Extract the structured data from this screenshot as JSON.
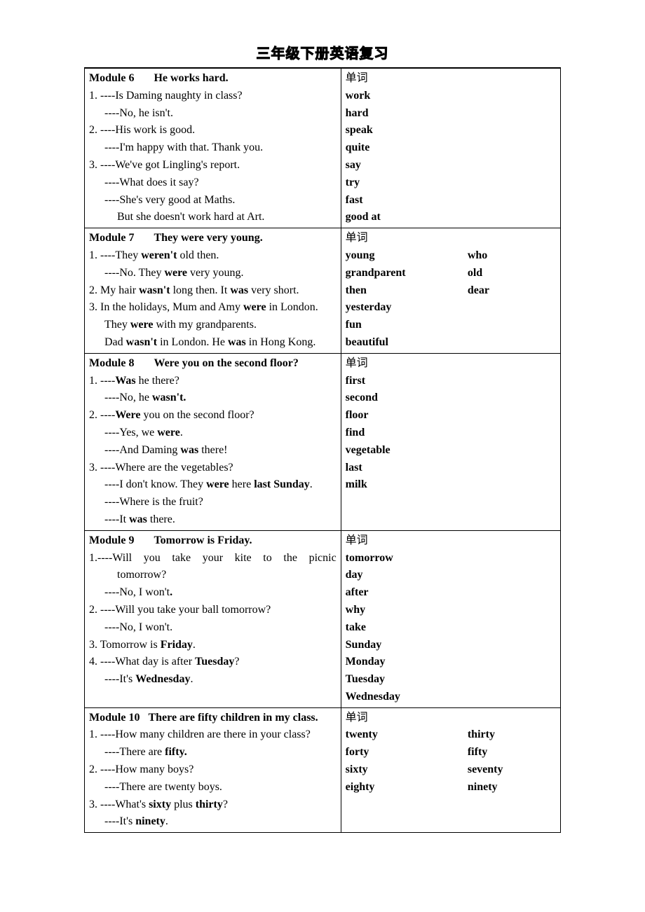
{
  "title": "三年级下册英语复习",
  "vocab_header": "单词",
  "mod6": {
    "header_a": "Module 6",
    "header_b": "He works hard.",
    "l1": "1. ----Is Daming naughty in class?",
    "l1a": "----No, he isn't.",
    "l2": "2. ----His work is good.",
    "l2a": "----I'm happy with that. Thank you.",
    "l3": "3. ----We've got Lingling's report.",
    "l3a": "----What does it say?",
    "l3b": "----She's very good at Maths.",
    "l3c": "But she doesn't work hard at Art.",
    "v": [
      "work",
      "hard",
      "speak",
      "quite",
      "say",
      "try",
      "fast",
      "good at"
    ]
  },
  "mod7": {
    "header_a": "Module 7",
    "header_b": "They were very young.",
    "l1a": "1. ----They ",
    "l1b": "weren't",
    "l1c": " old then.",
    "l1d": "----No. They ",
    "l1e": "were",
    "l1f": " very young.",
    "l2a": "2. My hair ",
    "l2b": "wasn't",
    "l2c": " long then. It ",
    "l2d": "was",
    "l2e": " very short.",
    "l3a": "3. In the holidays, Mum and Amy ",
    "l3b": "were",
    "l3c": " in London.",
    "l3d": "They ",
    "l3e": "were",
    "l3f": " with my grandparents.",
    "l3g": "Dad ",
    "l3h": "wasn't",
    "l3i": " in London. He ",
    "l3j": "was",
    "l3k": " in Hong Kong.",
    "v": [
      [
        "young",
        "who"
      ],
      [
        "grandparent",
        "old"
      ],
      [
        "then",
        "dear"
      ],
      [
        "yesterday",
        ""
      ],
      [
        "fun",
        ""
      ],
      [
        "beautiful",
        ""
      ]
    ]
  },
  "mod8": {
    "header_a": "Module 8",
    "header_b": "Were you on the second floor?",
    "l1a": "1. ----",
    "l1b": "Was",
    "l1c": " he there?",
    "l1d": "----No, he ",
    "l1e": "wasn't.",
    "l2a": "2. ----",
    "l2b": "Were",
    "l2c": " you on the second floor?",
    "l2d": "----Yes, we ",
    "l2e": "were",
    "l2f": ".",
    "l2g": "----And Daming ",
    "l2h": "was",
    "l2i": " there!",
    "l3a": "3. ----Where are the vegetables?",
    "l3b": "----I don't know. They ",
    "l3c": "were",
    "l3d": " here ",
    "l3e": "last Sunday",
    "l3f": ".",
    "l3g": "----Where is the fruit?",
    "l3h": "----It ",
    "l3i": "was",
    "l3j": " there.",
    "v": [
      "first",
      "second",
      "floor",
      "find",
      "vegetable",
      "last",
      "milk"
    ]
  },
  "mod9": {
    "header_a": "Module 9",
    "header_b": "Tomorrow is Friday.",
    "l1p1": "1.----Will",
    "l1p2": "you",
    "l1p3": "take",
    "l1p4": "your",
    "l1p5": "kite",
    "l1p6": "to",
    "l1p7": "the",
    "l1p8": "picnic",
    "l1b": "tomorrow?",
    "l1c": "----No, I won't",
    "l1d": ".",
    "l2a": "2. ----Will you take your ball tomorrow?",
    "l2b": "----No, I won't.",
    "l3a": "3. Tomorrow is ",
    "l3b": "Friday",
    "l3c": ".",
    "l4a": "4. ----What day is after ",
    "l4b": "Tuesday",
    "l4c": "?",
    "l4d": "----It's ",
    "l4e": "Wednesday",
    "l4f": ".",
    "v": [
      "tomorrow",
      "day",
      "after",
      "why",
      "take",
      "Sunday",
      "Monday",
      "Tuesday",
      "Wednesday"
    ]
  },
  "mod10": {
    "header_a": "Module 10",
    "header_b": "There are fifty children in my class.",
    "l1a": "1. ----How many children are there in your class?",
    "l1b": "----There are ",
    "l1c": "fifty.",
    "l2a": "2. ----How many boys?",
    "l2b": "----There are twenty boys.",
    "l3a": "3. ----What's ",
    "l3b": "sixty",
    "l3c": " plus ",
    "l3d": "thirty",
    "l3e": "?",
    "l3f": "----It's ",
    "l3g": "ninety",
    "l3h": ".",
    "v": [
      [
        "twenty",
        "thirty"
      ],
      [
        "forty",
        "fifty"
      ],
      [
        "sixty",
        "seventy"
      ],
      [
        "eighty",
        "ninety"
      ]
    ]
  }
}
